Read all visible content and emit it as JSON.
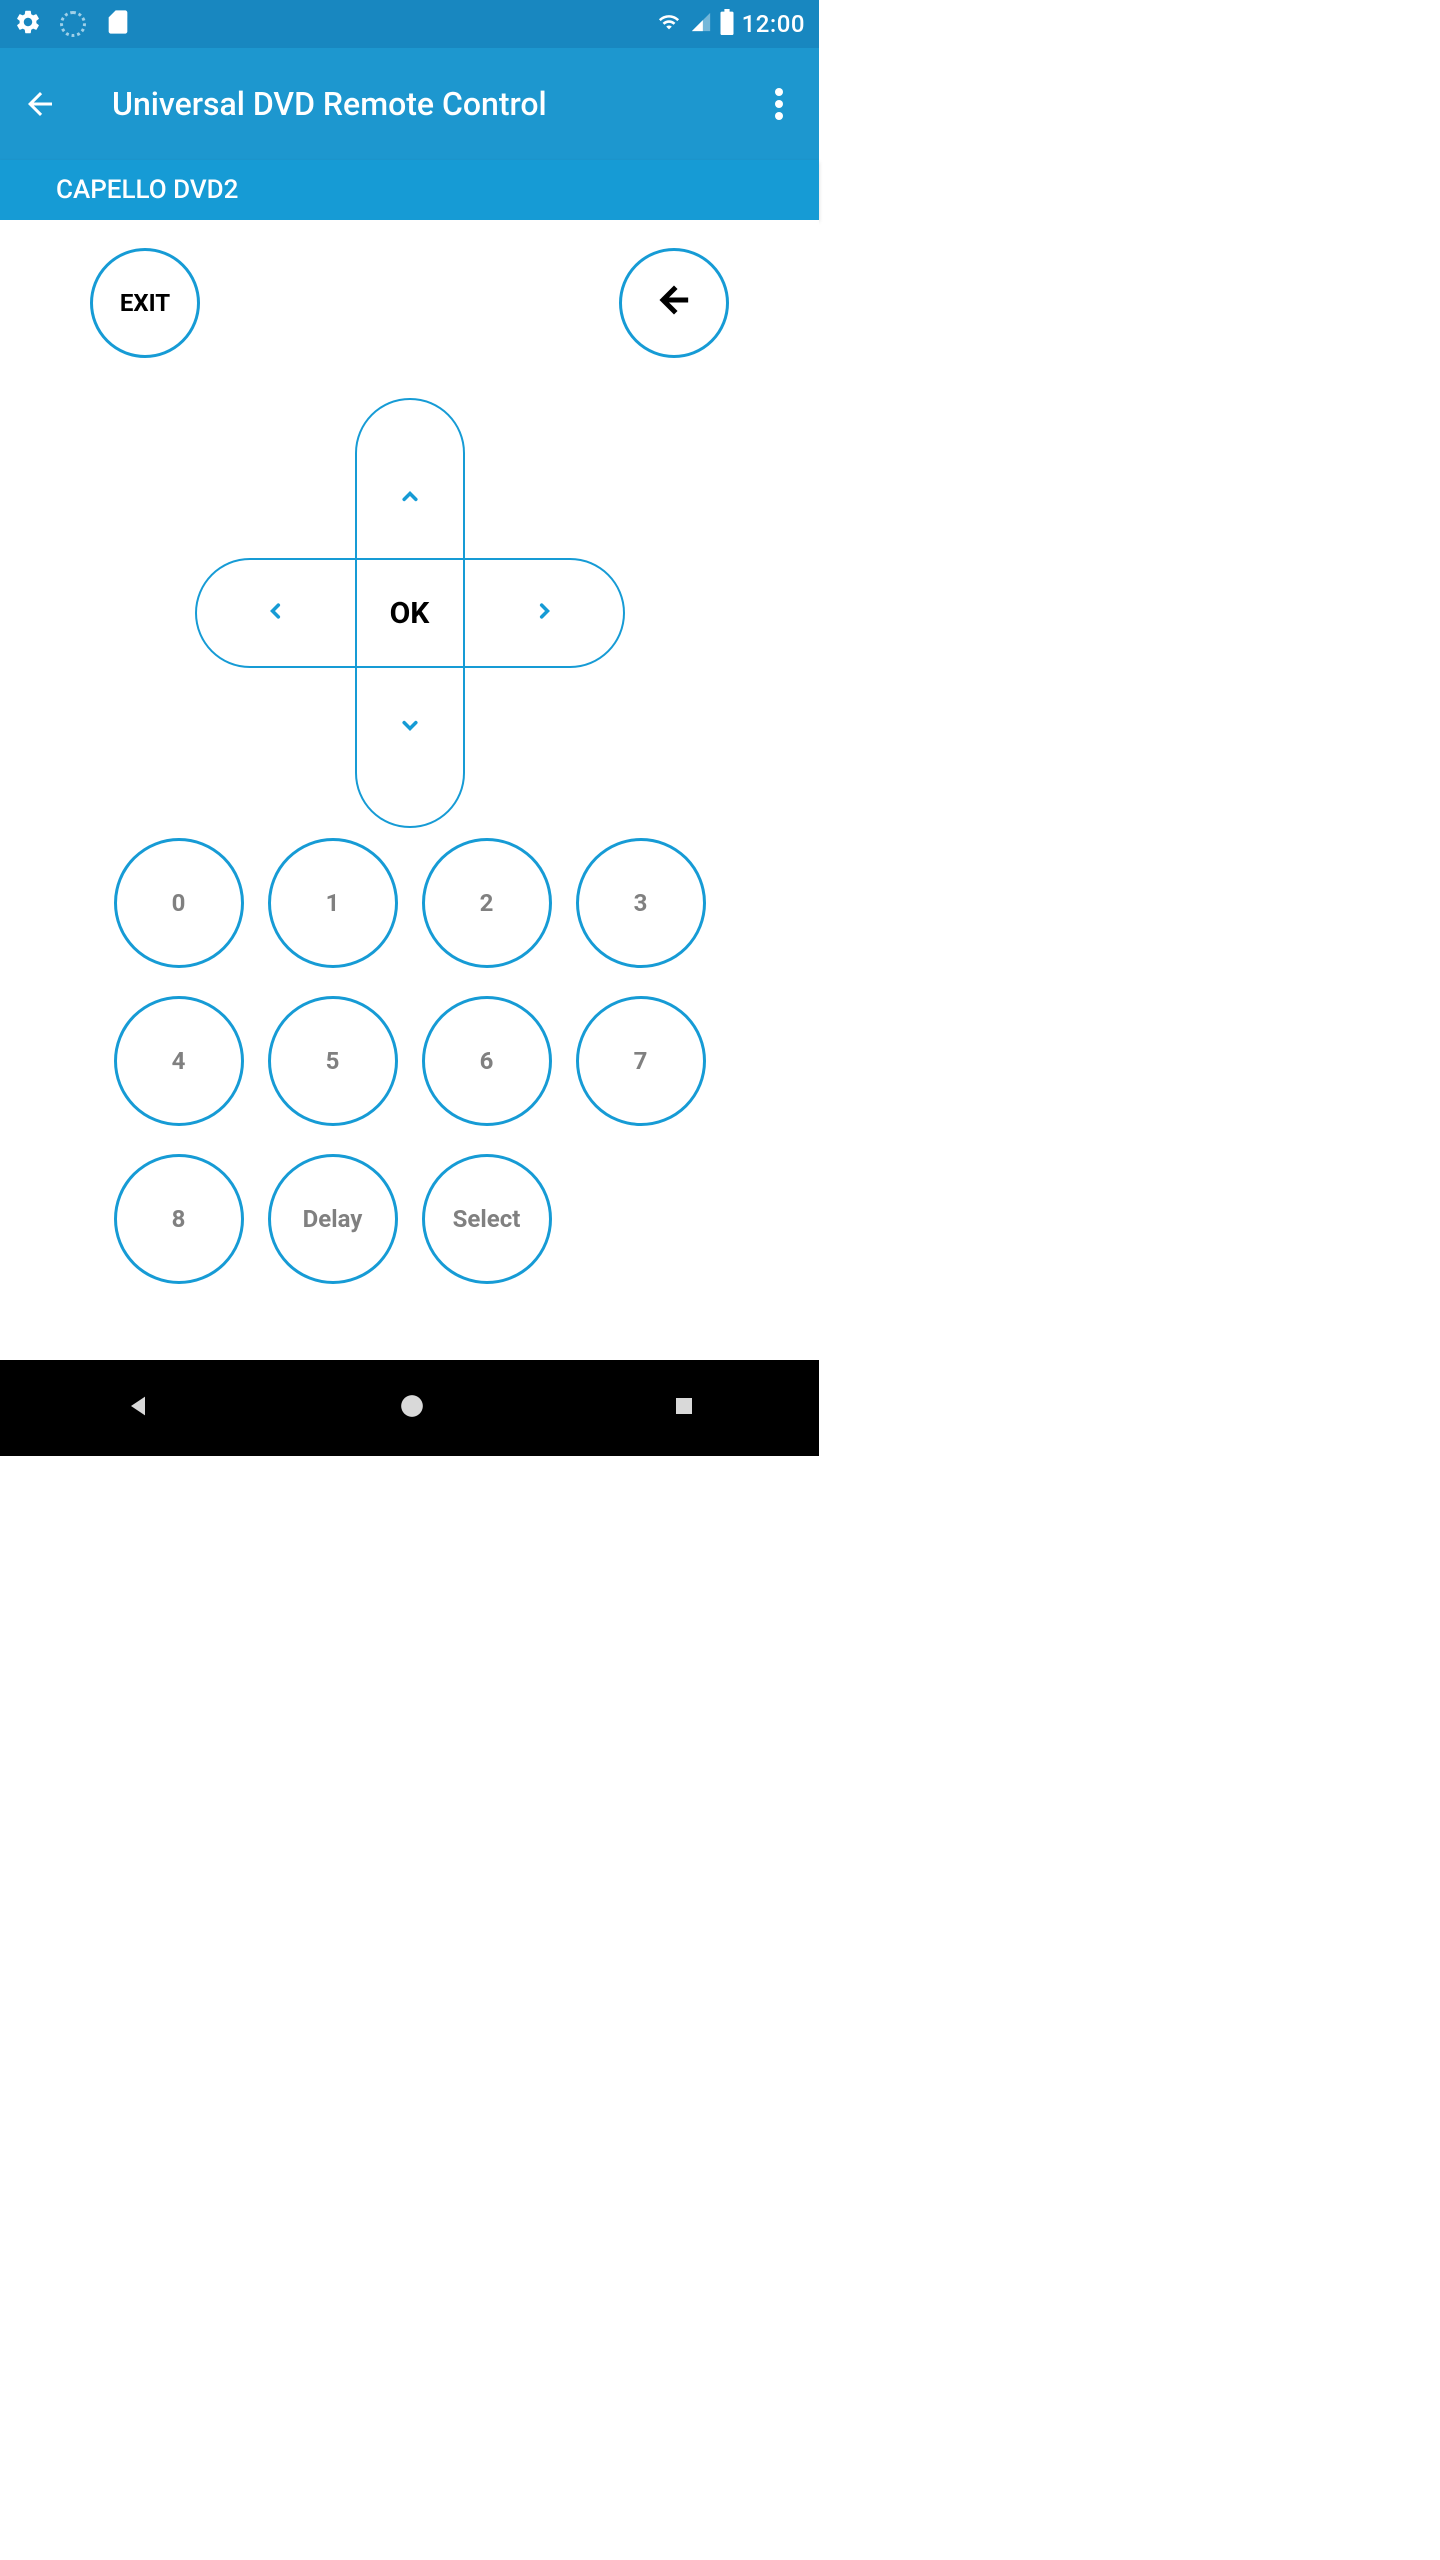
{
  "statusbar": {
    "time": "12:00"
  },
  "appbar": {
    "title": "Universal DVD Remote Control"
  },
  "device": {
    "name": "CAPELLO DVD2"
  },
  "remote": {
    "exit": "EXIT",
    "ok": "OK",
    "numpad": [
      "0",
      "1",
      "2",
      "3",
      "4",
      "5",
      "6",
      "7",
      "8",
      "Delay",
      "Select"
    ]
  },
  "colors": {
    "primary": "#169bd5",
    "appbar": "#1d97cf",
    "statusbar": "#1887c0"
  }
}
